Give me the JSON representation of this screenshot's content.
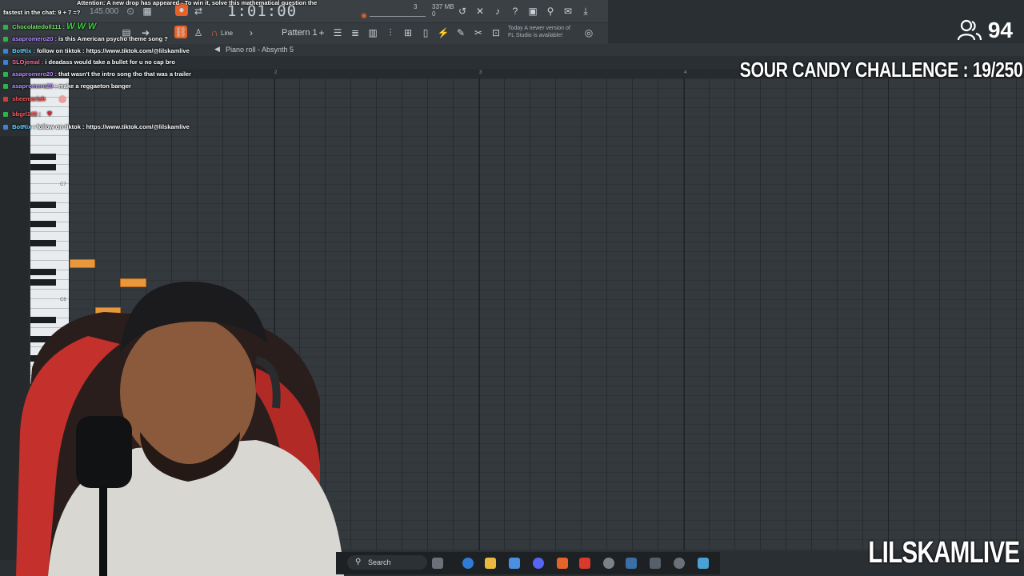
{
  "toolbar": {
    "time": "1:01:00",
    "bpm": "145.000",
    "pattern": "Pattern 1",
    "snap": "Line",
    "memory": "337 MB",
    "memory_sub": "0",
    "cpu_num": "3",
    "news_line1": "Today  A newer version of",
    "news_line2": "FL Studio is available!"
  },
  "piano_roll": {
    "title": "Piano roll - Absynth 5",
    "ruler": [
      "2",
      "3",
      "4"
    ],
    "key_labels": [
      "C7",
      "C6"
    ]
  },
  "chat": {
    "lines": [
      {
        "user": "",
        "text": "Attention: A new drop has appeared - To win it, solve this mathematical question the",
        "color": "#ffffff"
      },
      {
        "user": "",
        "text": "fastest in the chat: 9 + 7 =?",
        "color": "#ffffff"
      },
      {
        "user": "Chocolatedoll111 :",
        "text": "W W W",
        "color": "#7ee36b"
      },
      {
        "user": "asapromero20 :",
        "text": "is this American psycho theme song ?",
        "color": "#b58bff"
      },
      {
        "user": "BotRix :",
        "text": "follow on tiktok : https://www.tiktok.com/@lilskamlive",
        "color": "#6bd7ff"
      },
      {
        "user": "SLOjemal :",
        "text": "i deadass would take a bullet for u no cap bro",
        "color": "#ff6b9a"
      },
      {
        "user": "asapromero20 :",
        "text": "that wasn't the intro song tho that was a trailer",
        "color": "#b58bff"
      },
      {
        "user": "asapromero20 :",
        "text": "make a reggaeton banger",
        "color": "#b58bff"
      },
      {
        "user": "sheemariah",
        "text": "",
        "color": "#ff5e5e"
      },
      {
        "user": "bbgrl143 :",
        "text": "",
        "color": "#ff5e5e"
      },
      {
        "user": "BotRix :",
        "text": "follow on tiktok : https://www.tiktok.com/@lilskamlive",
        "color": "#6bd7ff"
      }
    ]
  },
  "overlay": {
    "viewers": "94",
    "challenge": "SOUR CANDY CHALLENGE : 19/250",
    "brand": "LILSKAMLIVE"
  },
  "taskbar": {
    "search_label": "Search"
  }
}
